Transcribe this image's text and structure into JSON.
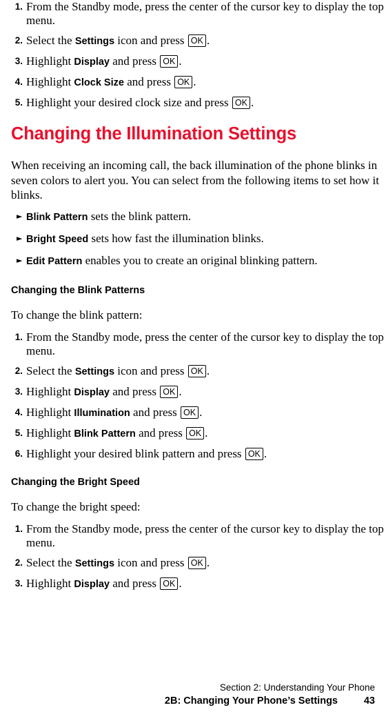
{
  "ok_key_label": "OK",
  "arrow_glyph": "►",
  "steps_top": [
    {
      "num": "1.",
      "pre": "From the Standby mode, press the center of the cursor key to display the top menu.",
      "bold": "",
      "post": "",
      "key": false
    },
    {
      "num": "2.",
      "pre": "Select the ",
      "bold": "Settings",
      "post": " icon and press ",
      "key": true,
      "tail": "."
    },
    {
      "num": "3.",
      "pre": "Highlight ",
      "bold": "Display",
      "post": " and press ",
      "key": true,
      "tail": "."
    },
    {
      "num": "4.",
      "pre": "Highlight ",
      "bold": "Clock Size",
      "post": " and press ",
      "key": true,
      "tail": "."
    },
    {
      "num": "5.",
      "pre": "Highlight your desired clock size and press ",
      "bold": "",
      "post": "",
      "key": true,
      "tail": "."
    }
  ],
  "section": {
    "title": "Changing the Illumination Settings",
    "paragraph": "When receiving an incoming call, the back illumination of the phone blinks in seven colors to alert you. You can select from the following items to set how it blinks.",
    "bullets": [
      {
        "bold": "Blink Pattern",
        "rest": " sets the blink pattern."
      },
      {
        "bold": "Bright Speed",
        "rest": " sets how fast the illumination blinks."
      },
      {
        "bold": "Edit Pattern",
        "rest": " enables you to create an original blinking pattern."
      }
    ]
  },
  "blink": {
    "heading": "Changing the Blink Patterns",
    "lead": "To change the blink pattern:",
    "steps": [
      {
        "num": "1.",
        "pre": "From the Standby mode, press the center of the cursor key to display the top menu.",
        "bold": "",
        "post": "",
        "key": false
      },
      {
        "num": "2.",
        "pre": "Select the ",
        "bold": "Settings",
        "post": " icon and press ",
        "key": true,
        "tail": "."
      },
      {
        "num": "3.",
        "pre": "Highlight ",
        "bold": "Display",
        "post": " and press ",
        "key": true,
        "tail": "."
      },
      {
        "num": "4.",
        "pre": "Highlight ",
        "bold": "Illumination",
        "post": " and press ",
        "key": true,
        "tail": "."
      },
      {
        "num": "5.",
        "pre": "Highlight ",
        "bold": "Blink Pattern",
        "post": " and press ",
        "key": true,
        "tail": "."
      },
      {
        "num": "6.",
        "pre": "Highlight your desired blink pattern and press ",
        "bold": "",
        "post": "",
        "key": true,
        "tail": "."
      }
    ]
  },
  "bright": {
    "heading": "Changing the Bright Speed",
    "lead": "To change the bright speed:",
    "steps": [
      {
        "num": "1.",
        "pre": "From the Standby mode, press the center of the cursor key to display the top menu.",
        "bold": "",
        "post": "",
        "key": false
      },
      {
        "num": "2.",
        "pre": "Select the ",
        "bold": "Settings",
        "post": " icon and press ",
        "key": true,
        "tail": "."
      },
      {
        "num": "3.",
        "pre": "Highlight ",
        "bold": "Display",
        "post": " and press ",
        "key": true,
        "tail": "."
      }
    ]
  },
  "footer": {
    "line1": "Section 2: Understanding Your Phone",
    "chapter": "2B: Changing Your Phone’s Settings",
    "page": "43"
  }
}
